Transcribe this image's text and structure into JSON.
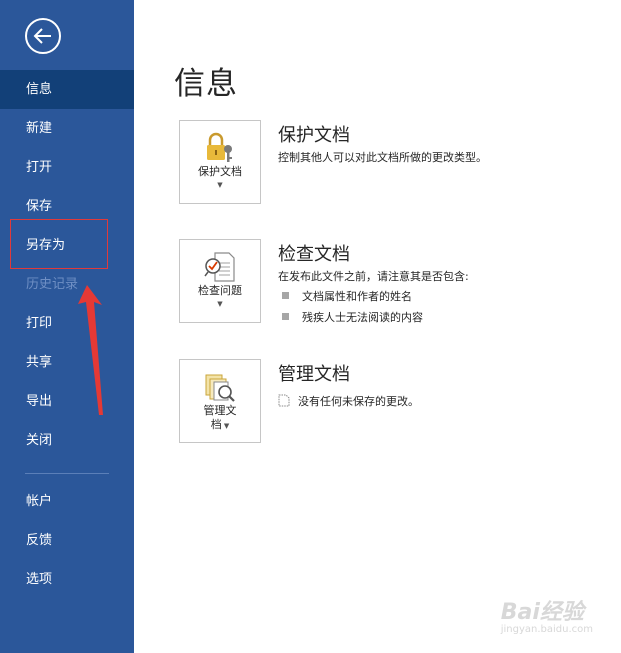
{
  "sidebar": {
    "items": [
      {
        "label": "信息"
      },
      {
        "label": "新建"
      },
      {
        "label": "打开"
      },
      {
        "label": "保存"
      },
      {
        "label": "另存为"
      },
      {
        "label": "历史记录"
      },
      {
        "label": "打印"
      },
      {
        "label": "共享"
      },
      {
        "label": "导出"
      },
      {
        "label": "关闭"
      },
      {
        "label": "帐户"
      },
      {
        "label": "反馈"
      },
      {
        "label": "选项"
      }
    ]
  },
  "main": {
    "title": "信息",
    "protect": {
      "button_label": "保护文档",
      "title": "保护文档",
      "desc": "控制其他人可以对此文档所做的更改类型。"
    },
    "inspect": {
      "button_label": "检查问题",
      "title": "检查文档",
      "desc": "在发布此文件之前，请注意其是否包含:",
      "bullets": [
        "文档属性和作者的姓名",
        "残疾人士无法阅读的内容"
      ]
    },
    "manage": {
      "button_label_line1": "管理文",
      "button_label_line2": "档",
      "title": "管理文档",
      "desc": "没有任何未保存的更改。"
    }
  },
  "watermark": {
    "main": "Bai经验",
    "sub": "jingyan.baidu.com"
  },
  "colors": {
    "sidebar": "#2b579a",
    "active": "#124078",
    "highlight_box": "#e03a3a"
  }
}
